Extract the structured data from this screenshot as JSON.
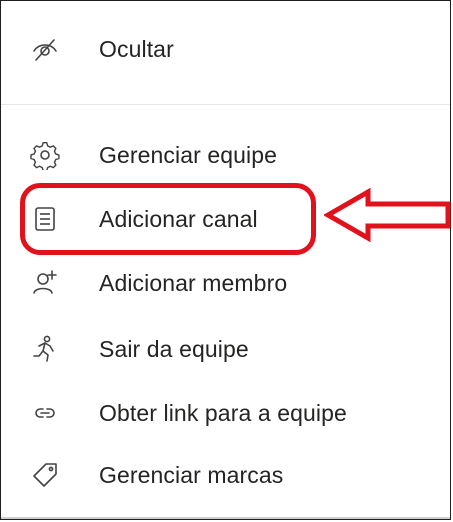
{
  "menu": {
    "items": [
      {
        "label": "Ocultar",
        "icon": "hide-icon"
      },
      {
        "label": "Gerenciar equipe",
        "icon": "gear-icon"
      },
      {
        "label": "Adicionar canal",
        "icon": "channel-icon"
      },
      {
        "label": "Adicionar membro",
        "icon": "add-member-icon"
      },
      {
        "label": "Sair da equipe",
        "icon": "leave-icon"
      },
      {
        "label": "Obter link para a equipe",
        "icon": "link-icon"
      },
      {
        "label": "Gerenciar marcas",
        "icon": "tag-icon"
      }
    ]
  },
  "annotation": {
    "color": "#e1121b"
  }
}
